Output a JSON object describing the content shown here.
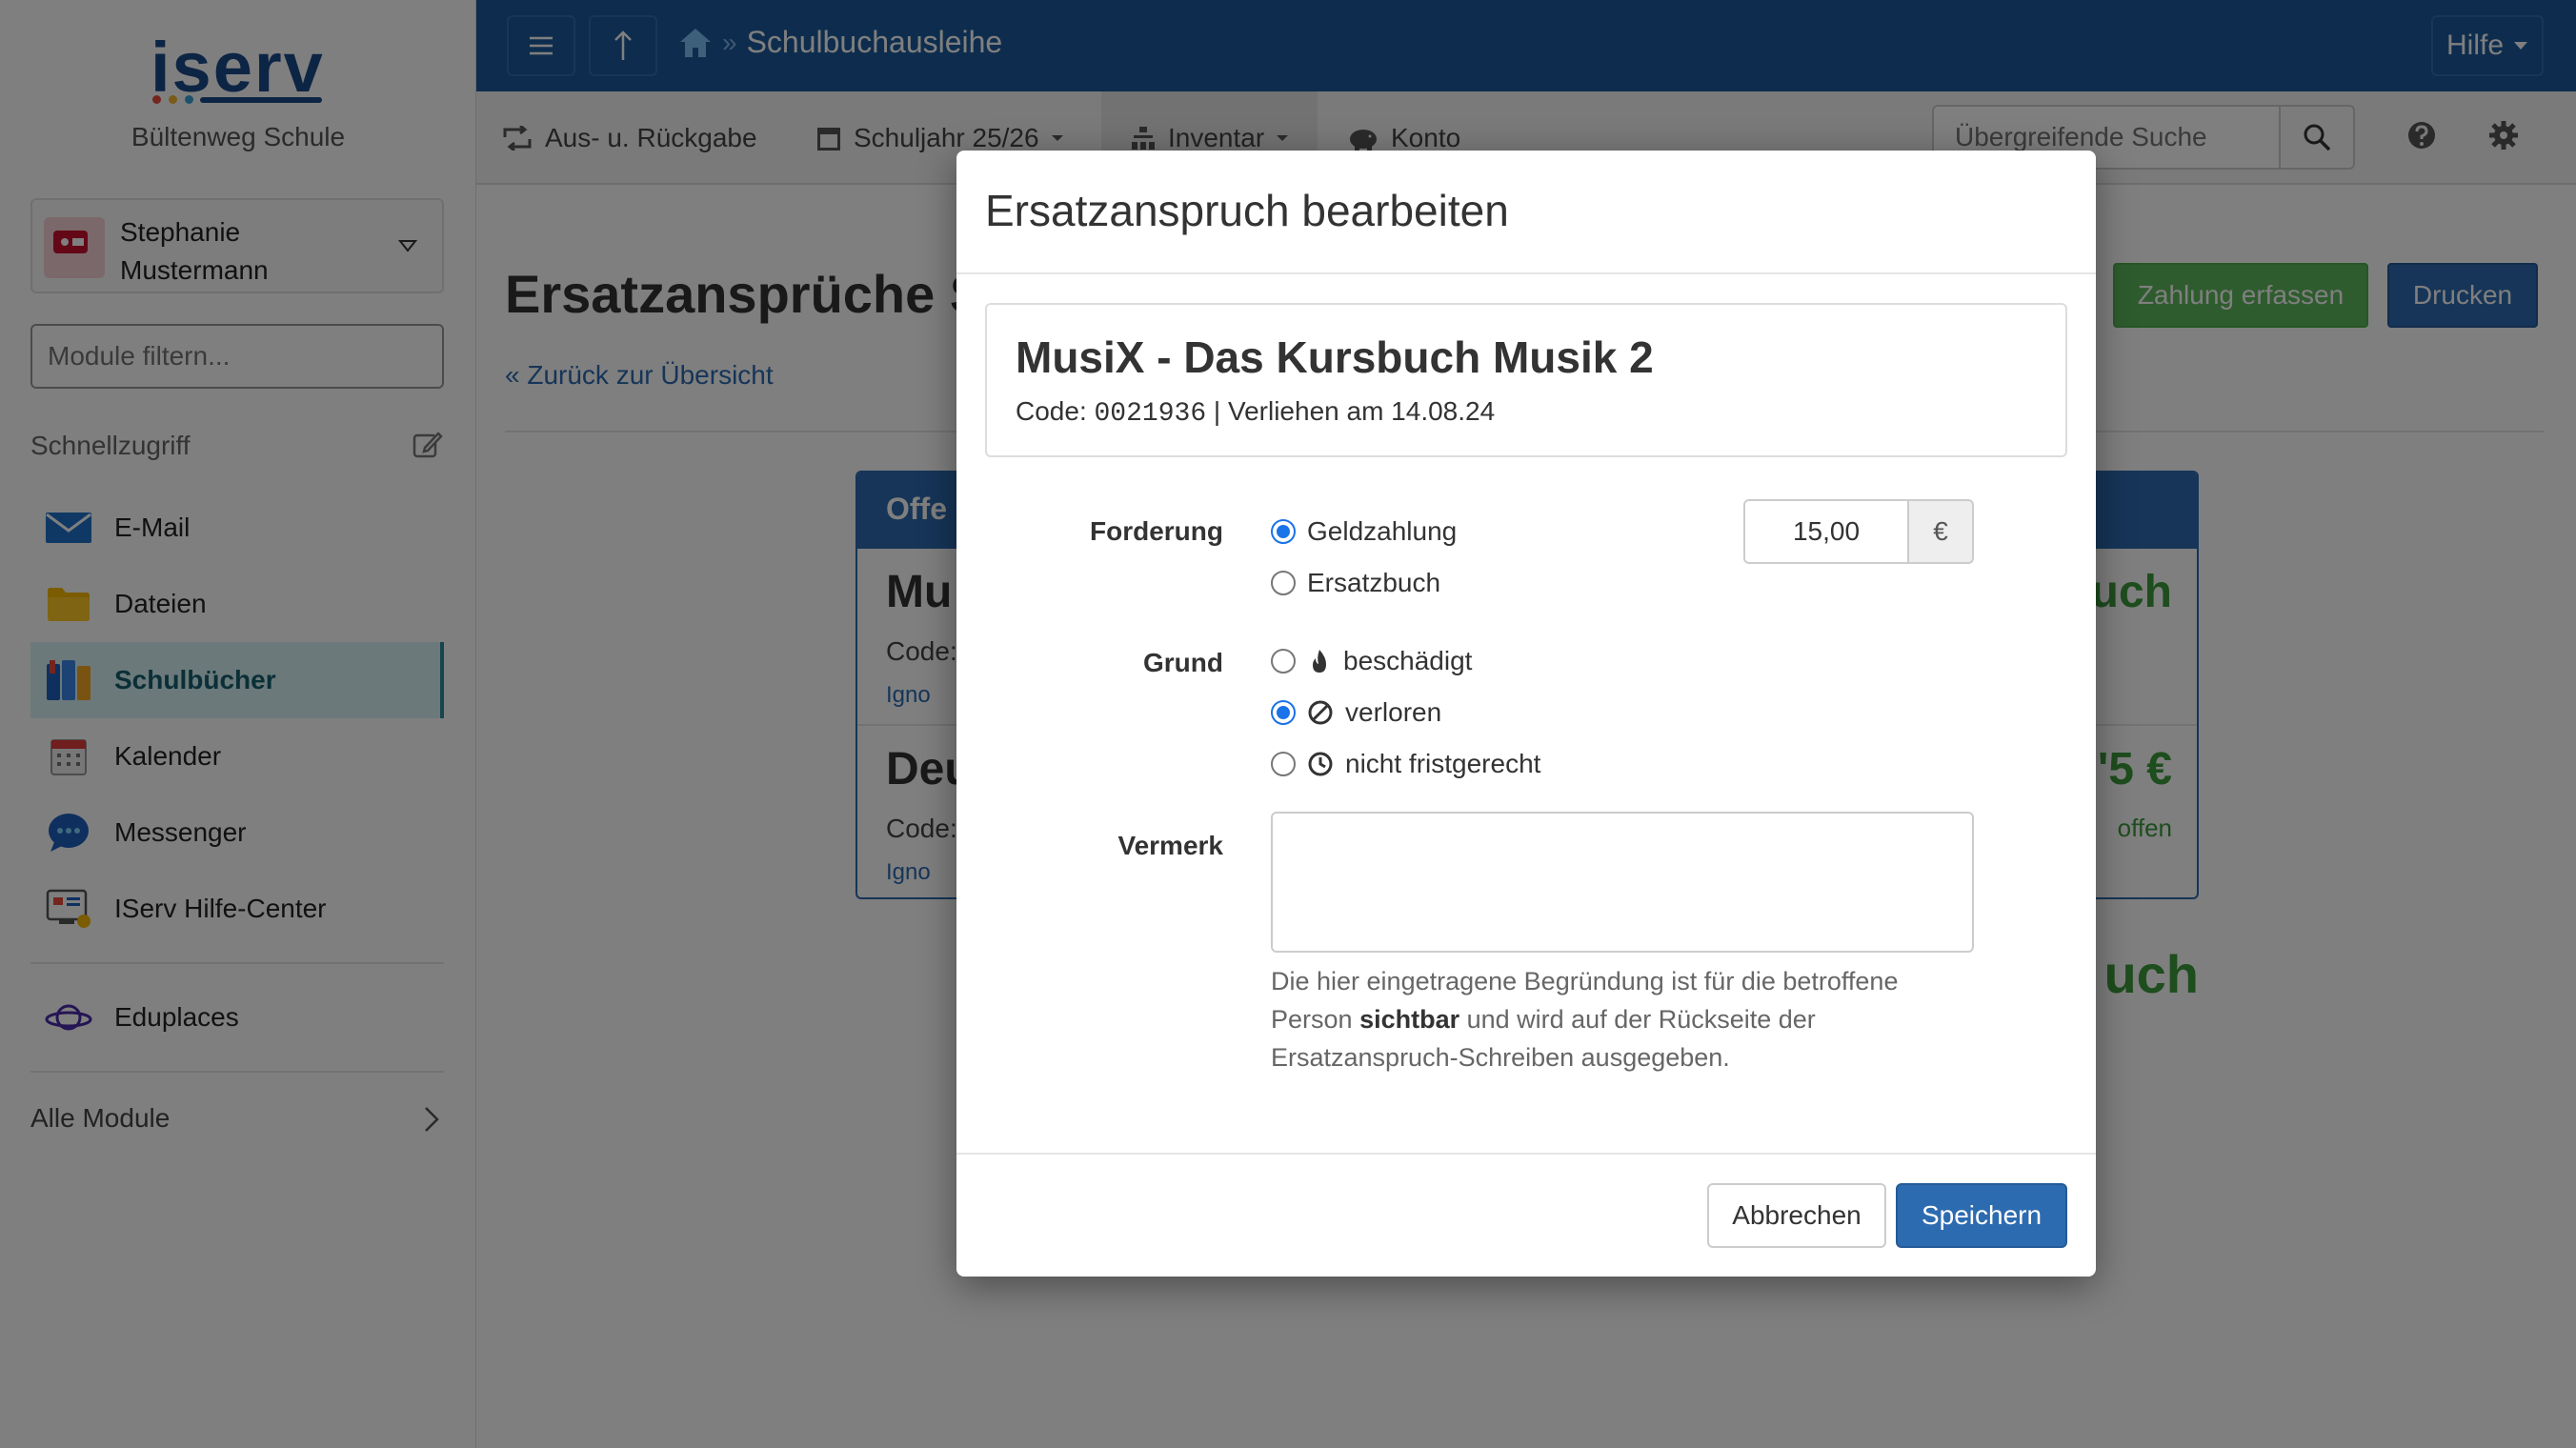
{
  "sidebar": {
    "logo_text": "iserv",
    "school": "Bültenweg Schule",
    "user_first": "Stephanie",
    "user_last": "Mustermann",
    "filter_placeholder": "Module filtern...",
    "quick_label": "Schnellzugriff",
    "items": [
      {
        "label": "E-Mail",
        "icon": "mail-icon"
      },
      {
        "label": "Dateien",
        "icon": "folder-icon"
      },
      {
        "label": "Schulbücher",
        "icon": "books-icon",
        "active": true
      },
      {
        "label": "Kalender",
        "icon": "calendar-icon"
      },
      {
        "label": "Messenger",
        "icon": "chat-icon"
      },
      {
        "label": "IServ Hilfe-Center",
        "icon": "help-center-icon"
      }
    ],
    "extra_item": {
      "label": "Eduplaces",
      "icon": "planet-icon"
    },
    "all_modules": "Alle Module"
  },
  "topbar": {
    "breadcrumb_sep": "»",
    "breadcrumb": "Schulbuchausleihe",
    "help": "Hilfe"
  },
  "subnav": {
    "items": [
      "Aus- u. Rückgabe",
      "Schuljahr 25/26",
      "Inventar",
      "Konto"
    ],
    "search_placeholder": "Übergreifende Suche"
  },
  "content": {
    "title": "Ersatzansprüche S",
    "back": "« Zurück zur Übersicht",
    "btn_payment": "Zahlung erfassen",
    "btn_print": "Drucken",
    "panel_head": "Offe",
    "rows": [
      {
        "title": "Mu",
        "code": "Code:",
        "ignore": "Igno",
        "right": "uch",
        "open": ""
      },
      {
        "title": "Deu",
        "code": "Code:",
        "ignore": "Igno",
        "right": "'5 €",
        "open": "offen"
      }
    ],
    "big_green": "uch"
  },
  "modal": {
    "title": "Ersatzanspruch bearbeiten",
    "book_title": "MusiX - Das Kursbuch Musik 2",
    "code_label": "Code:",
    "code": "0021936",
    "lent": "| Verliehen am 14.08.24",
    "forderung_label": "Forderung",
    "forderung_options": [
      "Geldzahlung",
      "Ersatzbuch"
    ],
    "amount": "15,00",
    "currency": "€",
    "grund_label": "Grund",
    "grund_options": [
      "beschädigt",
      "verloren",
      "nicht fristgerecht"
    ],
    "vermerk_label": "Vermerk",
    "help_1": "Die hier eingetragene Begründung ist für die betroffene Person ",
    "help_bold": "sichtbar",
    "help_2": " und wird auf der Rückseite der Ersatzanspruch-Schreiben ausgegeben.",
    "cancel": "Abbrechen",
    "save": "Speichern"
  },
  "colors": {
    "primary": "#1d5a9c",
    "accent": "#2d6bb0",
    "success": "#5cb85c"
  }
}
